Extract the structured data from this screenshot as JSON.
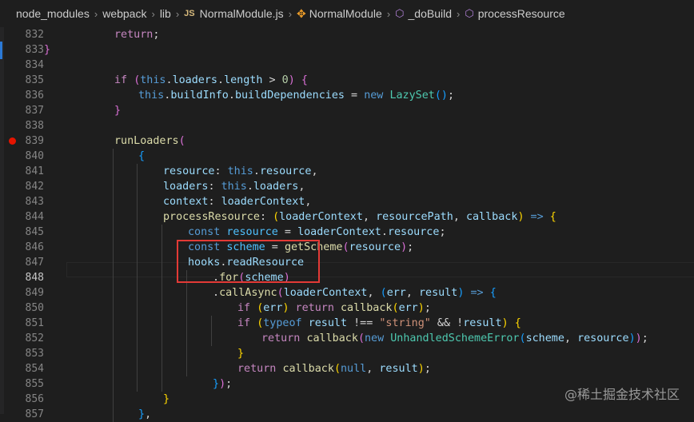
{
  "breadcrumb": {
    "items": [
      "node_modules",
      "webpack",
      "lib",
      "NormalModule.js",
      "NormalModule",
      "_doBuild",
      "processResource"
    ],
    "file_badge": "JS"
  },
  "gutter": {
    "line_numbers": [
      "832",
      "833",
      "834",
      "835",
      "836",
      "837",
      "838",
      "839",
      "840",
      "841",
      "842",
      "843",
      "844",
      "845",
      "846",
      "847",
      "848",
      "849",
      "850",
      "851",
      "852",
      "853",
      "854",
      "855",
      "856",
      "857"
    ],
    "active_line": "848",
    "breakpoint_line": "839"
  },
  "code": {
    "lines": [
      [
        [
          "kw",
          "return"
        ],
        [
          "pn",
          ";"
        ]
      ],
      [
        [
          "br2",
          "}"
        ]
      ],
      [],
      [
        [
          "kw",
          "if "
        ],
        [
          "br2",
          "("
        ],
        [
          "st",
          "this"
        ],
        [
          "pn",
          "."
        ],
        [
          "pr",
          "loaders"
        ],
        [
          "pn",
          "."
        ],
        [
          "pr",
          "length"
        ],
        [
          "pn",
          " > "
        ],
        [
          "num",
          "0"
        ],
        [
          "br2",
          ")"
        ],
        [
          "pn",
          " "
        ],
        [
          "br2",
          "{"
        ]
      ],
      [
        [
          "st",
          "this"
        ],
        [
          "pn",
          "."
        ],
        [
          "pr",
          "buildInfo"
        ],
        [
          "pn",
          "."
        ],
        [
          "pr",
          "buildDependencies"
        ],
        [
          "pn",
          " = "
        ],
        [
          "st",
          "new "
        ],
        [
          "cl",
          "LazySet"
        ],
        [
          "br3",
          "()"
        ],
        [
          "pn",
          ";"
        ]
      ],
      [
        [
          "br2",
          "}"
        ]
      ],
      [],
      [
        [
          "fn",
          "runLoaders"
        ],
        [
          "br2",
          "("
        ]
      ],
      [
        [
          "br3",
          "{"
        ]
      ],
      [
        [
          "pr",
          "resource"
        ],
        [
          "pn",
          ": "
        ],
        [
          "st",
          "this"
        ],
        [
          "pn",
          "."
        ],
        [
          "pr",
          "resource"
        ],
        [
          "pn",
          ","
        ]
      ],
      [
        [
          "pr",
          "loaders"
        ],
        [
          "pn",
          ": "
        ],
        [
          "st",
          "this"
        ],
        [
          "pn",
          "."
        ],
        [
          "pr",
          "loaders"
        ],
        [
          "pn",
          ","
        ]
      ],
      [
        [
          "pr",
          "context"
        ],
        [
          "pn",
          ": "
        ],
        [
          "pr",
          "loaderContext"
        ],
        [
          "pn",
          ","
        ]
      ],
      [
        [
          "fn",
          "processResource"
        ],
        [
          "pn",
          ": "
        ],
        [
          "br1",
          "("
        ],
        [
          "pr",
          "loaderContext"
        ],
        [
          "pn",
          ", "
        ],
        [
          "pr",
          "resourcePath"
        ],
        [
          "pn",
          ", "
        ],
        [
          "pr",
          "callback"
        ],
        [
          "br1",
          ")"
        ],
        [
          "st",
          " => "
        ],
        [
          "br1",
          "{"
        ]
      ],
      [
        [
          "st",
          "const "
        ],
        [
          "cn",
          "resource"
        ],
        [
          "pn",
          " = "
        ],
        [
          "pr",
          "loaderContext"
        ],
        [
          "pn",
          "."
        ],
        [
          "pr",
          "resource"
        ],
        [
          "pn",
          ";"
        ]
      ],
      [
        [
          "st",
          "const "
        ],
        [
          "cn",
          "scheme"
        ],
        [
          "pn",
          " = "
        ],
        [
          "fn",
          "getScheme"
        ],
        [
          "br2",
          "("
        ],
        [
          "pr",
          "resource"
        ],
        [
          "br2",
          ")"
        ],
        [
          "pn",
          ";"
        ]
      ],
      [
        [
          "pr",
          "hooks"
        ],
        [
          "pn",
          "."
        ],
        [
          "pr",
          "readResource"
        ]
      ],
      [
        [
          "pn",
          "."
        ],
        [
          "fn",
          "for"
        ],
        [
          "br2",
          "("
        ],
        [
          "pr",
          "scheme"
        ],
        [
          "br2",
          ")"
        ]
      ],
      [
        [
          "pn",
          "."
        ],
        [
          "fn",
          "callAsync"
        ],
        [
          "br2",
          "("
        ],
        [
          "pr",
          "loaderContext"
        ],
        [
          "pn",
          ", "
        ],
        [
          "br3",
          "("
        ],
        [
          "pr",
          "err"
        ],
        [
          "pn",
          ", "
        ],
        [
          "pr",
          "result"
        ],
        [
          "br3",
          ")"
        ],
        [
          "st",
          " => "
        ],
        [
          "br3",
          "{"
        ]
      ],
      [
        [
          "kw",
          "if "
        ],
        [
          "br1",
          "("
        ],
        [
          "pr",
          "err"
        ],
        [
          "br1",
          ")"
        ],
        [
          "kw",
          " return "
        ],
        [
          "fn",
          "callback"
        ],
        [
          "br1",
          "("
        ],
        [
          "pr",
          "err"
        ],
        [
          "br1",
          ")"
        ],
        [
          "pn",
          ";"
        ]
      ],
      [
        [
          "kw",
          "if "
        ],
        [
          "br1",
          "("
        ],
        [
          "st",
          "typeof "
        ],
        [
          "pr",
          "result"
        ],
        [
          "pn",
          " !== "
        ],
        [
          "str",
          "\"string\""
        ],
        [
          "pn",
          " && !"
        ],
        [
          "pr",
          "result"
        ],
        [
          "br1",
          ")"
        ],
        [
          "pn",
          " "
        ],
        [
          "br1",
          "{"
        ]
      ],
      [
        [
          "kw",
          "return "
        ],
        [
          "fn",
          "callback"
        ],
        [
          "br2",
          "("
        ],
        [
          "st",
          "new "
        ],
        [
          "cl",
          "UnhandledSchemeError"
        ],
        [
          "br3",
          "("
        ],
        [
          "pr",
          "scheme"
        ],
        [
          "pn",
          ", "
        ],
        [
          "pr",
          "resource"
        ],
        [
          "br3",
          ")"
        ],
        [
          "br2",
          ")"
        ],
        [
          "pn",
          ";"
        ]
      ],
      [
        [
          "br1",
          "}"
        ]
      ],
      [
        [
          "kw",
          "return "
        ],
        [
          "fn",
          "callback"
        ],
        [
          "br1",
          "("
        ],
        [
          "st",
          "null"
        ],
        [
          "pn",
          ", "
        ],
        [
          "pr",
          "result"
        ],
        [
          "br1",
          ")"
        ],
        [
          "pn",
          ";"
        ]
      ],
      [
        [
          "br3",
          "}"
        ],
        [
          "br2",
          ")"
        ],
        [
          "pn",
          ";"
        ]
      ],
      [
        [
          "br1",
          "}"
        ]
      ],
      [
        [
          "br3",
          "}"
        ],
        [
          "pn",
          ","
        ]
      ]
    ]
  },
  "watermark": "@稀土掘金技术社区",
  "colors": {
    "background": "#1e1e1e",
    "highlight_box": "#e33a36",
    "breakpoint": "#e51400"
  }
}
